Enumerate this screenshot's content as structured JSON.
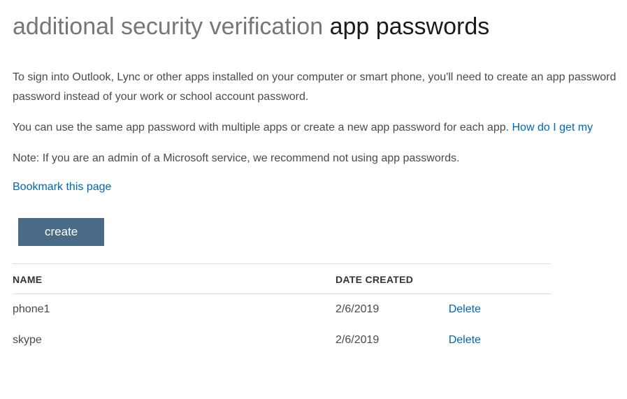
{
  "header": {
    "title_prefix": "additional security verification",
    "title_current": "app passwords"
  },
  "intro": {
    "line1": "To sign into Outlook, Lync or other apps installed on your computer or smart phone, you'll need to create an app password",
    "line2": "password instead of your work or school account password."
  },
  "reuse_text": "You can use the same app password with multiple apps or create a new app password for each app. ",
  "reuse_link": "How do I get my",
  "admin_note": "Note: If you are an admin of a Microsoft service, we recommend not using app passwords.",
  "bookmark_label": "Bookmark this page",
  "create_label": "create",
  "table": {
    "col_name": "NAME",
    "col_date": "DATE CREATED",
    "rows": [
      {
        "name": "phone1",
        "date": "2/6/2019",
        "action": "Delete"
      },
      {
        "name": "skype",
        "date": "2/6/2019",
        "action": "Delete"
      }
    ]
  }
}
